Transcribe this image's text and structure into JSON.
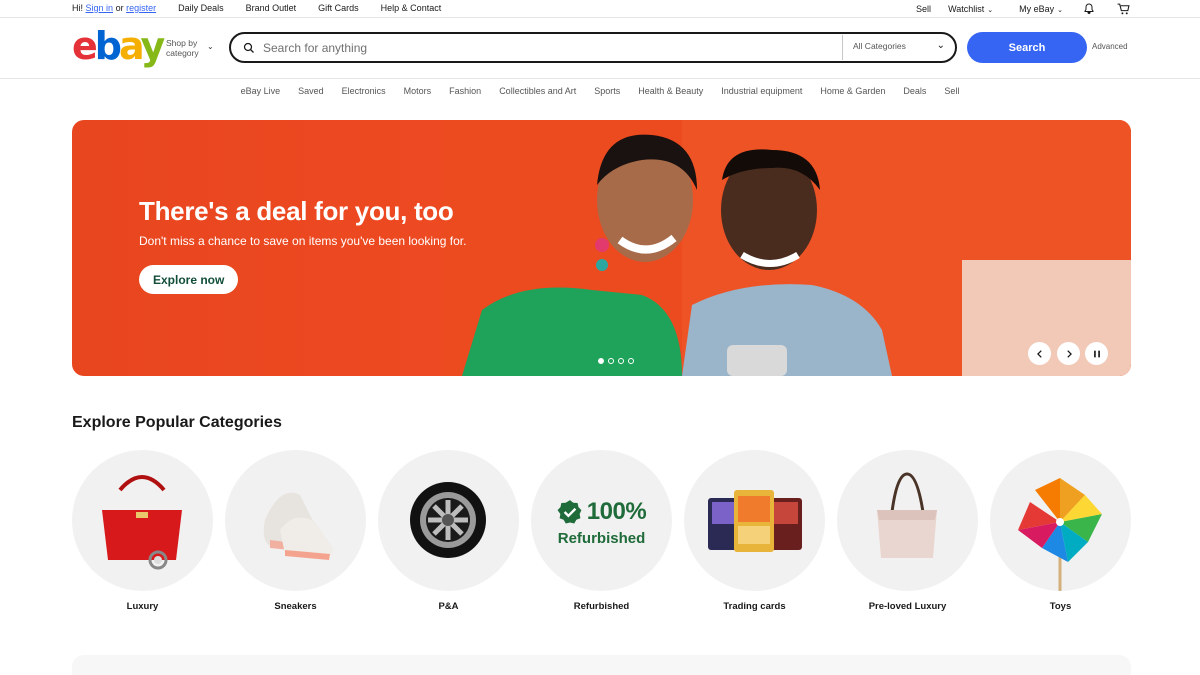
{
  "topbar": {
    "greeting": "Hi!",
    "sign_in": "Sign in",
    "or": "or",
    "register": "register",
    "links": [
      "Daily Deals",
      "Brand Outlet",
      "Gift Cards",
      "Help & Contact"
    ],
    "sell": "Sell",
    "watchlist": "Watchlist",
    "my_ebay": "My eBay",
    "icons": [
      "bell-icon",
      "cart-icon"
    ]
  },
  "header": {
    "logo": "ebay",
    "shop_by_line1": "Shop by",
    "shop_by_line2": "category",
    "search_placeholder": "Search for anything",
    "category_select": "All Categories",
    "search_button": "Search",
    "advanced": "Advanced"
  },
  "nav": [
    "eBay Live",
    "Saved",
    "Electronics",
    "Motors",
    "Fashion",
    "Collectibles and Art",
    "Sports",
    "Health & Beauty",
    "Industrial equipment",
    "Home & Garden",
    "Deals",
    "Sell"
  ],
  "hero": {
    "title": "There's a deal for you, too",
    "subtitle": "Don't miss a chance to save on items you've been looking for.",
    "cta": "Explore now",
    "slides_total": 4,
    "active_slide": 1,
    "colors": {
      "background": "#ee4a22",
      "cta_text": "#124e3a"
    }
  },
  "categories": {
    "title": "Explore Popular Categories",
    "items": [
      {
        "label": "Luxury"
      },
      {
        "label": "Sneakers"
      },
      {
        "label": "P&A"
      },
      {
        "label": "Refurbished",
        "badge_pct": "100%",
        "badge_word": "Refurbished"
      },
      {
        "label": "Trading cards"
      },
      {
        "label": "Pre-loved Luxury"
      },
      {
        "label": "Toys"
      }
    ]
  },
  "colors": {
    "accent": "#3665f3",
    "logo_e": "#e53238",
    "logo_b": "#0064d2",
    "logo_a": "#f5af02",
    "logo_y": "#86b817"
  }
}
